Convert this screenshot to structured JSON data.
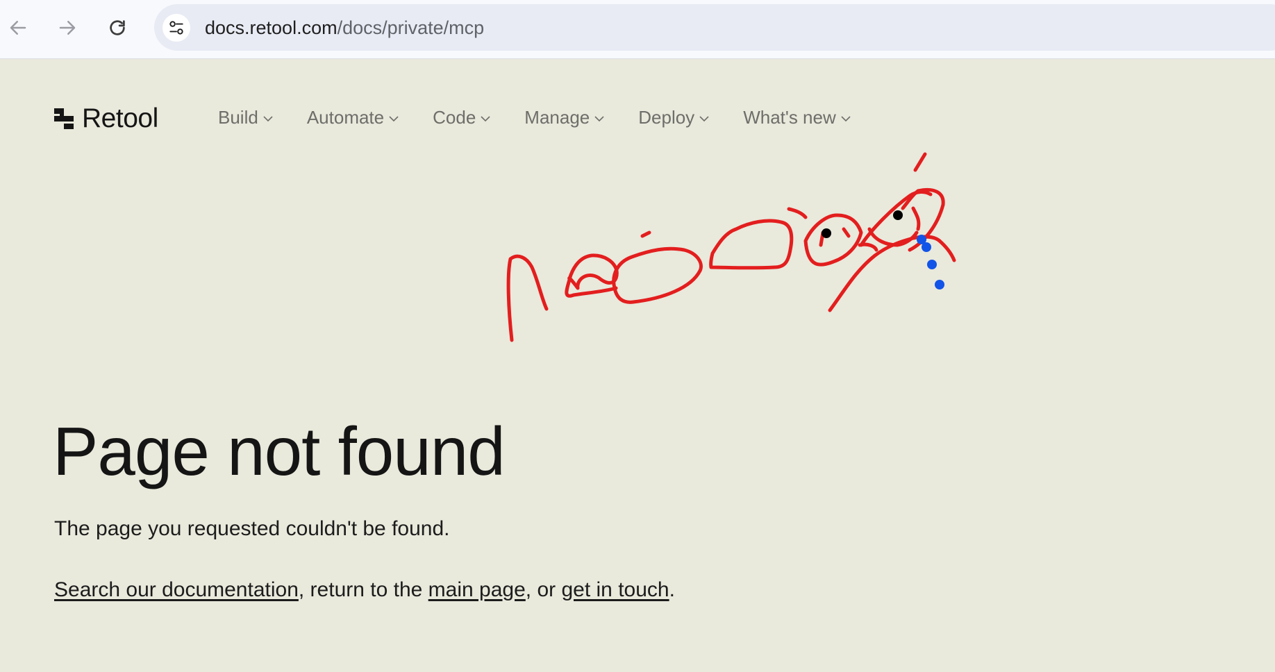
{
  "browser": {
    "url_host": "docs.retool.com",
    "url_path": "/docs/private/mcp"
  },
  "header": {
    "logo_text": "Retool",
    "nav": [
      {
        "label": "Build"
      },
      {
        "label": "Automate"
      },
      {
        "label": "Code"
      },
      {
        "label": "Manage"
      },
      {
        "label": "Deploy"
      },
      {
        "label": "What's new"
      }
    ]
  },
  "main": {
    "title": "Page not found",
    "subtitle": "The page you requested couldn't be found.",
    "link_search": "Search our documentation",
    "text_1": ", return to the ",
    "link_main": "main page",
    "text_2": ", or ",
    "link_contact": "get in touch",
    "text_3": "."
  },
  "colors": {
    "page_background": "#e9e9dc",
    "doodle_red": "#e31e1e",
    "doodle_blue": "#1254e8",
    "doodle_black": "#000000"
  }
}
